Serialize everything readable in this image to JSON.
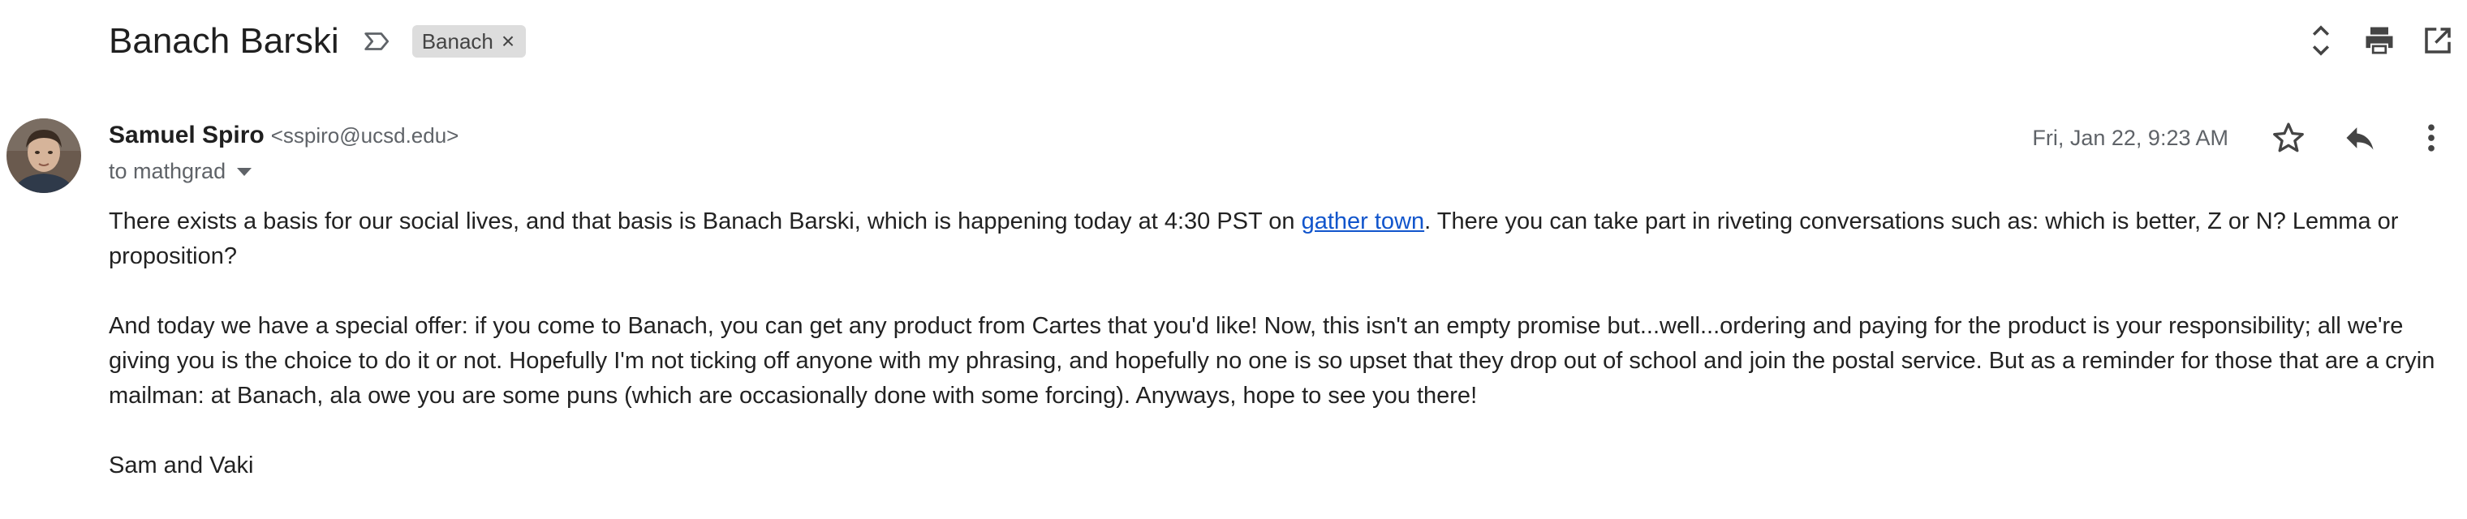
{
  "subject": "Banach Barski",
  "label": {
    "name": "Banach",
    "icon": "label-arrow-icon"
  },
  "header_actions": [
    {
      "name": "expand-all-icon"
    },
    {
      "name": "print-icon"
    },
    {
      "name": "open-in-new-window-icon"
    }
  ],
  "sender": {
    "name": "Samuel Spiro",
    "email": "<sspiro@ucsd.edu>",
    "to": "to mathgrad"
  },
  "date": "Fri, Jan 22, 9:23 AM",
  "message_actions": [
    {
      "name": "star-icon"
    },
    {
      "name": "reply-icon"
    },
    {
      "name": "more-options-icon"
    }
  ],
  "body": {
    "p1_before": "There exists a basis for our social lives, and that basis is Banach Barski, which is happening today at 4:30 PST on ",
    "p1_link": "gather town",
    "p1_after": ".  There you can take part in riveting conversations such as: which is better, Z or N?  Lemma or proposition?",
    "p2": "And today we have a special offer: if you come to Banach, you can get any product from Cartes that you'd like!  Now, this isn't an empty promise but...well...ordering and paying for the product is your responsibility; all we're giving you is the choice to do it or not.  Hopefully I'm not ticking off anyone with my phrasing, and hopefully no one is so upset that they drop out of school and join the postal service.  But as a reminder for those that are a cryin mailman: at Banach, ala owe you are some puns (which are occasionally done with some forcing).  Anyways, hope to see you there!",
    "signature": "Sam and Vaki"
  },
  "colors": {
    "link": "#1155cc",
    "muted": "#5f6368",
    "chip_bg": "#dddddd"
  }
}
